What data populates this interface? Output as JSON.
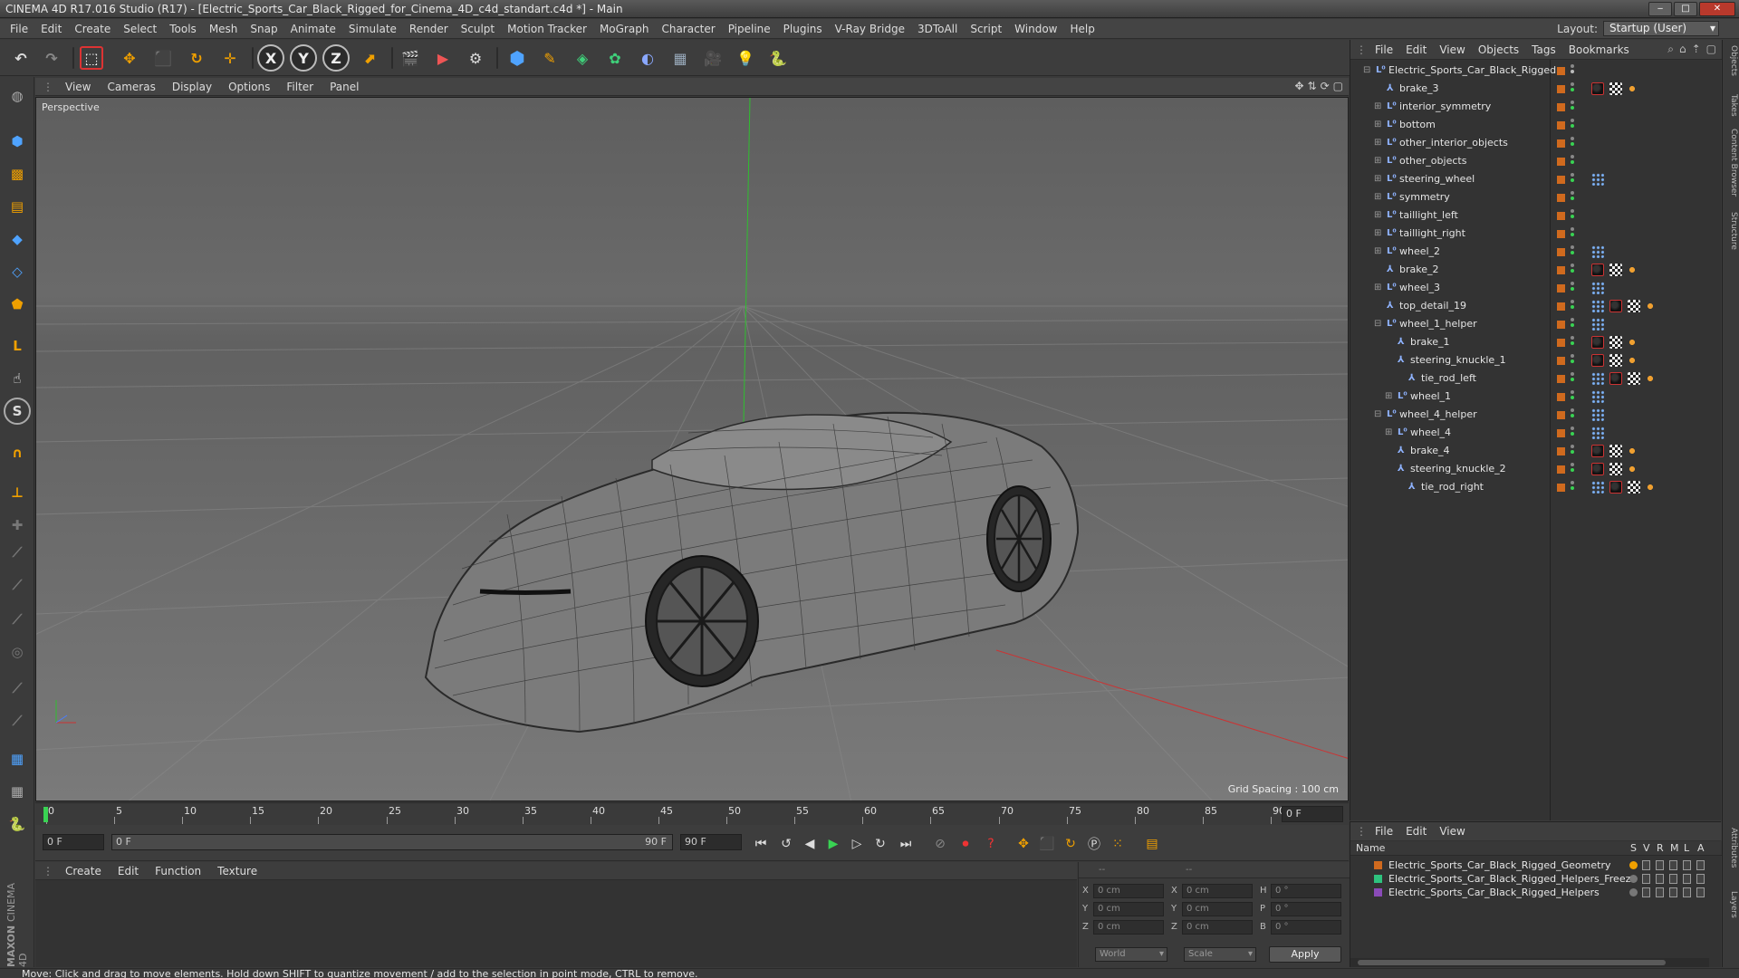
{
  "window": {
    "title": "CINEMA 4D R17.016 Studio (R17) - [Electric_Sports_Car_Black_Rigged_for_Cinema_4D_c4d_standart.c4d *] - Main"
  },
  "menubar": {
    "items": [
      "File",
      "Edit",
      "Create",
      "Select",
      "Tools",
      "Mesh",
      "Snap",
      "Animate",
      "Simulate",
      "Render",
      "Sculpt",
      "Motion Tracker",
      "MoGraph",
      "Character",
      "Pipeline",
      "Plugins",
      "V-Ray Bridge",
      "3DToAll",
      "Script",
      "Window",
      "Help"
    ],
    "layout_label": "Layout:",
    "layout_value": "Startup (User)"
  },
  "toolbar": {
    "icons": [
      "undo-icon",
      "redo-icon",
      "live-selection-icon",
      "move-icon",
      "scale-icon",
      "rotate-icon",
      "transform-icon",
      "x-axis-icon",
      "y-axis-icon",
      "z-axis-icon",
      "world-coordinates-icon",
      "render-view-icon",
      "render-picture-viewer-icon",
      "edit-render-settings-icon",
      "cube-primitive-icon",
      "pen-spline-icon",
      "subdivision-surface-icon",
      "cloner-icon",
      "deformer-icon",
      "floor-icon",
      "camera-icon",
      "light-icon",
      "python-icon"
    ],
    "axis_x": "X",
    "axis_y": "Y",
    "axis_z": "Z"
  },
  "viewport": {
    "menu": [
      "View",
      "Cameras",
      "Display",
      "Options",
      "Filter",
      "Panel"
    ],
    "label": "Perspective",
    "grid_spacing": "Grid Spacing : 100 cm"
  },
  "timeline": {
    "ticks": [
      "0",
      "5",
      "10",
      "15",
      "20",
      "25",
      "30",
      "35",
      "40",
      "45",
      "50",
      "55",
      "60",
      "65",
      "70",
      "75",
      "80",
      "85",
      "90"
    ],
    "end_frame": "0 F"
  },
  "transport": {
    "current_frame": "0 F",
    "range_start": "0 F",
    "range_end": "90 F",
    "max_frame": "90 F"
  },
  "material_panel": {
    "menu": [
      "Create",
      "Edit",
      "Function",
      "Texture"
    ]
  },
  "coordinates": {
    "header_a": "--",
    "header_b": "--",
    "rows": [
      {
        "a_label": "X",
        "a_val": "0 cm",
        "b_label": "X",
        "b_val": "0 cm",
        "c_label": "H",
        "c_val": "0 °"
      },
      {
        "a_label": "Y",
        "a_val": "0 cm",
        "b_label": "Y",
        "b_val": "0 cm",
        "c_label": "P",
        "c_val": "0 °"
      },
      {
        "a_label": "Z",
        "a_val": "0 cm",
        "b_label": "Z",
        "b_val": "0 cm",
        "c_label": "B",
        "c_val": "0 °"
      }
    ],
    "mode": "World",
    "transform": "Scale",
    "apply": "Apply"
  },
  "object_manager": {
    "menu": [
      "File",
      "Edit",
      "View",
      "Objects",
      "Tags",
      "Bookmarks"
    ],
    "objects": [
      {
        "name": "Electric_Sports_Car_Black_Rigged",
        "depth": 0,
        "type": "null",
        "tags": []
      },
      {
        "name": "brake_3",
        "depth": 1,
        "type": "bone",
        "tags": [
          "mat",
          "chk",
          "ph"
        ]
      },
      {
        "name": "interior_symmetry",
        "depth": 1,
        "type": "null",
        "tags": []
      },
      {
        "name": "bottom",
        "depth": 1,
        "type": "null",
        "tags": []
      },
      {
        "name": "other_interior_objects",
        "depth": 1,
        "type": "null",
        "tags": []
      },
      {
        "name": "other_objects",
        "depth": 1,
        "type": "null",
        "tags": []
      },
      {
        "name": "steering_wheel",
        "depth": 1,
        "type": "null",
        "tags": [
          "dot"
        ]
      },
      {
        "name": "symmetry",
        "depth": 1,
        "type": "null",
        "tags": []
      },
      {
        "name": "taillight_left",
        "depth": 1,
        "type": "null",
        "tags": []
      },
      {
        "name": "taillight_right",
        "depth": 1,
        "type": "null",
        "tags": []
      },
      {
        "name": "wheel_2",
        "depth": 1,
        "type": "null",
        "tags": [
          "dot"
        ]
      },
      {
        "name": "brake_2",
        "depth": 1,
        "type": "bone",
        "tags": [
          "mat",
          "chk",
          "ph"
        ]
      },
      {
        "name": "wheel_3",
        "depth": 1,
        "type": "null",
        "tags": [
          "dot"
        ]
      },
      {
        "name": "top_detail_19",
        "depth": 1,
        "type": "bone",
        "tags": [
          "dot",
          "mat",
          "chk",
          "ph"
        ]
      },
      {
        "name": "wheel_1_helper",
        "depth": 1,
        "type": "null",
        "tags": [
          "dot"
        ]
      },
      {
        "name": "brake_1",
        "depth": 2,
        "type": "bone",
        "tags": [
          "mat",
          "chk",
          "ph"
        ]
      },
      {
        "name": "steering_knuckle_1",
        "depth": 2,
        "type": "bone",
        "tags": [
          "mat",
          "chk",
          "ph"
        ]
      },
      {
        "name": "tie_rod_left",
        "depth": 3,
        "type": "bone",
        "tags": [
          "dot",
          "mat",
          "chk",
          "ph"
        ]
      },
      {
        "name": "wheel_1",
        "depth": 2,
        "type": "null",
        "tags": [
          "dot"
        ]
      },
      {
        "name": "wheel_4_helper",
        "depth": 1,
        "type": "null",
        "tags": [
          "dot"
        ]
      },
      {
        "name": "wheel_4",
        "depth": 2,
        "type": "null",
        "tags": [
          "dot"
        ]
      },
      {
        "name": "brake_4",
        "depth": 2,
        "type": "bone",
        "tags": [
          "mat",
          "chk",
          "ph"
        ]
      },
      {
        "name": "steering_knuckle_2",
        "depth": 2,
        "type": "bone",
        "tags": [
          "mat",
          "chk",
          "ph"
        ]
      },
      {
        "name": "tie_rod_right",
        "depth": 3,
        "type": "bone",
        "tags": [
          "dot",
          "mat",
          "chk",
          "ph"
        ]
      }
    ]
  },
  "side_tabs": [
    "Objects",
    "Takes",
    "Content Browser",
    "Structure"
  ],
  "side_tabs_lower": [
    "Attributes",
    "Layers"
  ],
  "layer_manager": {
    "menu": [
      "File",
      "Edit",
      "View"
    ],
    "header": {
      "name": "Name",
      "s": "S",
      "v": "V",
      "r": "R",
      "m": "M",
      "l": "L",
      "a": "A"
    },
    "layers": [
      {
        "name": "Electric_Sports_Car_Black_Rigged_Geometry",
        "color": "#d06a1e"
      },
      {
        "name": "Electric_Sports_Car_Black_Rigged_Helpers_Freeze",
        "color": "#2ec27e"
      },
      {
        "name": "Electric_Sports_Car_Black_Rigged_Helpers",
        "color": "#8a4bb8"
      }
    ]
  },
  "status": {
    "text": "Move: Click and drag to move elements. Hold down SHIFT to quantize movement / add to the selection in point mode, CTRL to remove."
  },
  "brand": {
    "company": "MAXON",
    "product": "CINEMA 4D"
  }
}
